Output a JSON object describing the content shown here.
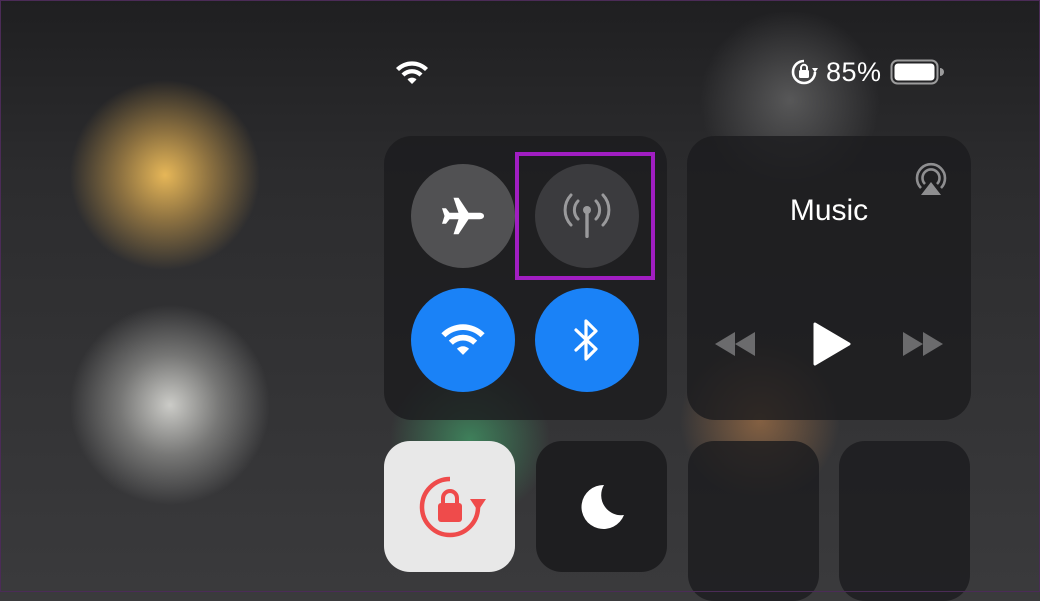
{
  "status_bar": {
    "wifi_icon": "wifi-icon",
    "rotation_lock_icon": "rotation-lock-icon",
    "battery_percent": "85%",
    "battery_level": 0.85
  },
  "connectivity": {
    "airplane_mode": {
      "icon": "airplane-icon",
      "state": "off"
    },
    "cellular_data": {
      "icon": "antenna-icon",
      "state": "off",
      "highlighted": true
    },
    "wifi": {
      "icon": "wifi-icon",
      "state": "on"
    },
    "bluetooth": {
      "icon": "bluetooth-icon",
      "state": "on"
    }
  },
  "music": {
    "title": "Music",
    "airplay_icon": "airplay-icon",
    "controls": [
      "rewind-icon",
      "play-icon",
      "fast-forward-icon"
    ]
  },
  "tiles": {
    "rotation_lock": {
      "icon": "rotation-lock-icon",
      "state": "on"
    },
    "do_not_disturb": {
      "icon": "moon-icon",
      "state": "off"
    },
    "brightness_slider": "slider",
    "volume_slider": "slider"
  },
  "colors": {
    "accent_blue": "#1a82f7",
    "highlight": "#a11ec2",
    "rotation_lock_red": "#ef4b4b"
  }
}
